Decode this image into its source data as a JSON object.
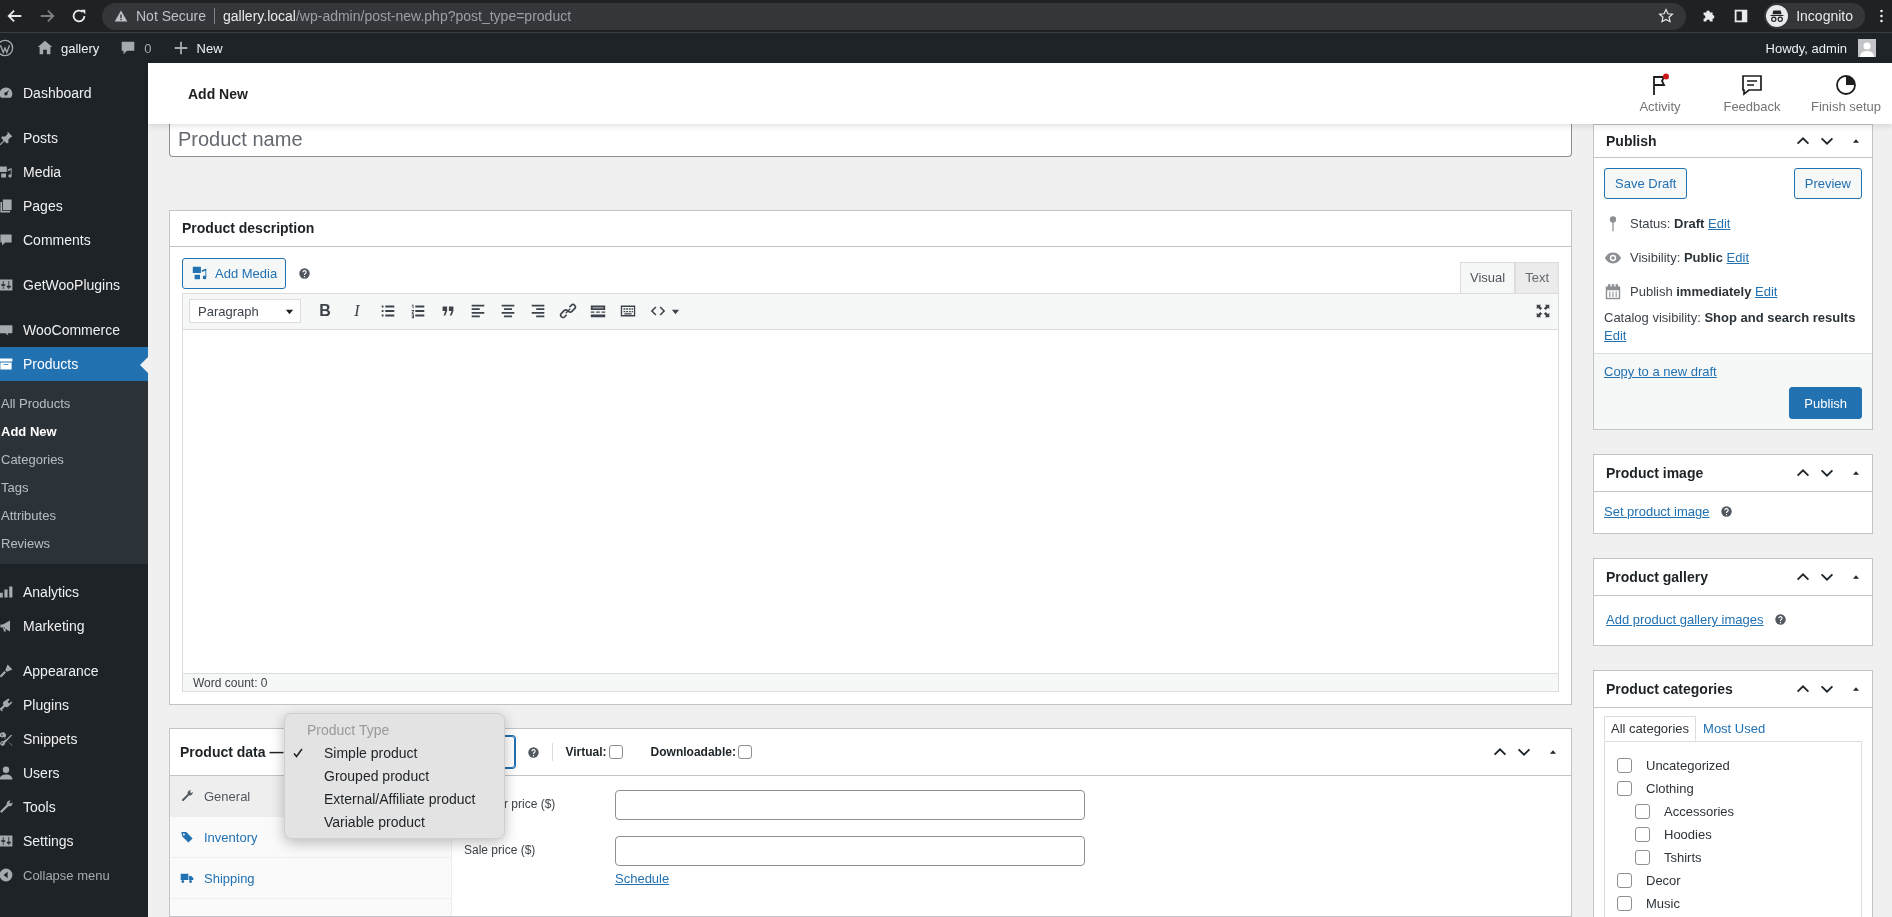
{
  "browser": {
    "security": "Not Secure",
    "url": {
      "host": "gallery.local",
      "path": "/wp-admin/post-new.php?post_type=product"
    },
    "profile": "Incognito"
  },
  "admin_bar": {
    "site": "gallery",
    "comments": "0",
    "new": "New",
    "greeting": "Howdy, admin"
  },
  "sidebar": {
    "groups": [
      [
        {
          "label": "Dashboard",
          "selected": false
        }
      ],
      [
        {
          "label": "Posts",
          "selected": false
        },
        {
          "label": "Media",
          "selected": false
        },
        {
          "label": "Pages",
          "selected": false
        },
        {
          "label": "Comments",
          "selected": false
        }
      ],
      [
        {
          "label": "GetWooPlugins",
          "selected": false
        }
      ],
      [
        {
          "label": "WooCommerce",
          "selected": false
        },
        {
          "label": "Products",
          "selected": true,
          "children": [
            {
              "label": "All Products",
              "selected": false
            },
            {
              "label": "Add New",
              "selected": true
            },
            {
              "label": "Categories",
              "selected": false
            },
            {
              "label": "Tags",
              "selected": false
            },
            {
              "label": "Attributes",
              "selected": false
            },
            {
              "label": "Reviews",
              "selected": false
            }
          ]
        }
      ],
      [
        {
          "label": "Analytics",
          "selected": false
        },
        {
          "label": "Marketing",
          "selected": false
        }
      ],
      [
        {
          "label": "Appearance",
          "selected": false
        },
        {
          "label": "Plugins",
          "selected": false
        },
        {
          "label": "Snippets",
          "selected": false
        },
        {
          "label": "Users",
          "selected": false
        },
        {
          "label": "Tools",
          "selected": false
        },
        {
          "label": "Settings",
          "selected": false
        }
      ]
    ],
    "collapse": "Collapse menu"
  },
  "header": {
    "title": "Add New",
    "actions": [
      {
        "label": "Activity",
        "unread": true
      },
      {
        "label": "Feedback",
        "unread": false
      },
      {
        "label": "Finish setup",
        "unread": false
      }
    ]
  },
  "product_name": {
    "placeholder": "Product name"
  },
  "description": {
    "title": "Product description",
    "add_media": "Add Media",
    "tabs": [
      {
        "label": "Visual",
        "selected": true
      },
      {
        "label": "Text",
        "selected": false
      }
    ],
    "format": "Paragraph",
    "bold": "B",
    "italic": "I",
    "word_count": "Word count: 0"
  },
  "product_data": {
    "title": "Product data —",
    "virtual": {
      "label": "Virtual:",
      "checked": false
    },
    "downloadable": {
      "label": "Downloadable:",
      "checked": false
    },
    "tabs": [
      {
        "label": "General",
        "selected": true
      },
      {
        "label": "Inventory",
        "selected": false
      },
      {
        "label": "Shipping",
        "selected": false
      }
    ],
    "fields": [
      {
        "label": "r price ($)"
      },
      {
        "label": "Sale price ($)",
        "link": "Schedule"
      }
    ],
    "type_menu": {
      "heading": "Product Type",
      "options": [
        {
          "label": "Simple product",
          "selected": true
        },
        {
          "label": "Grouped product",
          "selected": false
        },
        {
          "label": "External/Affiliate product",
          "selected": false
        },
        {
          "label": "Variable product",
          "selected": false
        }
      ]
    }
  },
  "publish": {
    "title": "Publish",
    "save_draft": "Save Draft",
    "preview": "Preview",
    "rows": [
      {
        "kind": "status",
        "label": "Status:",
        "value": "Draft",
        "link": "Edit"
      },
      {
        "kind": "visibility",
        "label": "Visibility:",
        "value": "Public",
        "link": "Edit"
      },
      {
        "kind": "schedule",
        "label": "Publish",
        "value": "immediately",
        "link": "Edit"
      },
      {
        "kind": "catalog",
        "label": "Catalog visibility:",
        "value": "Shop and search results",
        "link": "Edit"
      }
    ],
    "copy_link": "Copy to a new draft",
    "publish_button": "Publish"
  },
  "product_image": {
    "title": "Product image",
    "link": "Set product image"
  },
  "product_gallery": {
    "title": "Product gallery",
    "link": "Add product gallery images"
  },
  "product_categories": {
    "title": "Product categories",
    "tabs": [
      {
        "label": "All categories",
        "selected": true
      },
      {
        "label": "Most Used",
        "selected": false
      }
    ],
    "items": [
      {
        "label": "Uncategorized",
        "checked": false
      },
      {
        "label": "Clothing",
        "checked": false,
        "children": [
          {
            "label": "Accessories",
            "checked": false
          },
          {
            "label": "Hoodies",
            "checked": false
          },
          {
            "label": "Tshirts",
            "checked": false
          }
        ]
      },
      {
        "label": "Decor",
        "checked": false
      },
      {
        "label": "Music",
        "checked": false
      }
    ]
  }
}
